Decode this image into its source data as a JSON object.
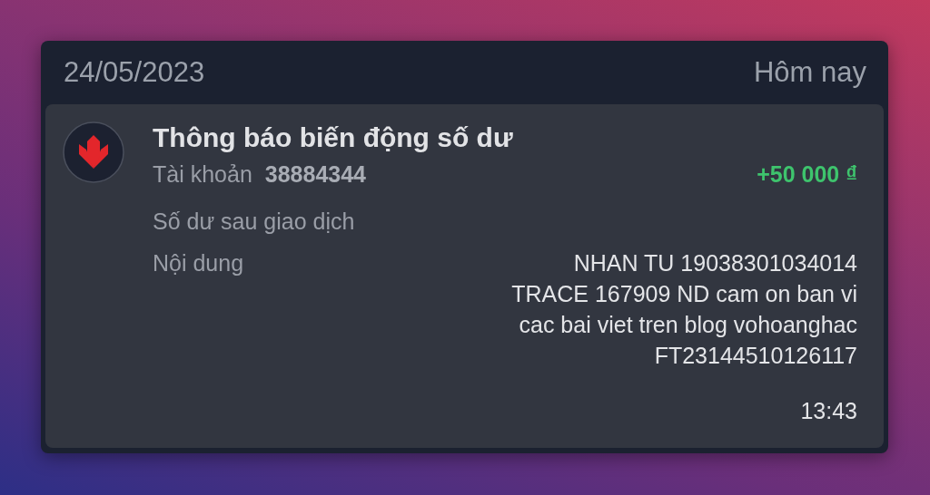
{
  "header": {
    "date": "24/05/2023",
    "day": "Hôm nay"
  },
  "notification": {
    "title": "Thông báo biến động số dư",
    "account_label": "Tài khoản",
    "account_number": "38884344",
    "amount": "+50 000 ₫",
    "balance_label": "Số dư sau giao dịch",
    "content_label": "Nội dung",
    "content_lines": [
      "NHAN TU 19038301034014",
      "TRACE 167909 ND cam on ban vi",
      "cac bai viet tren blog vohoanghac",
      "FT23144510126117"
    ],
    "time": "13:43"
  }
}
